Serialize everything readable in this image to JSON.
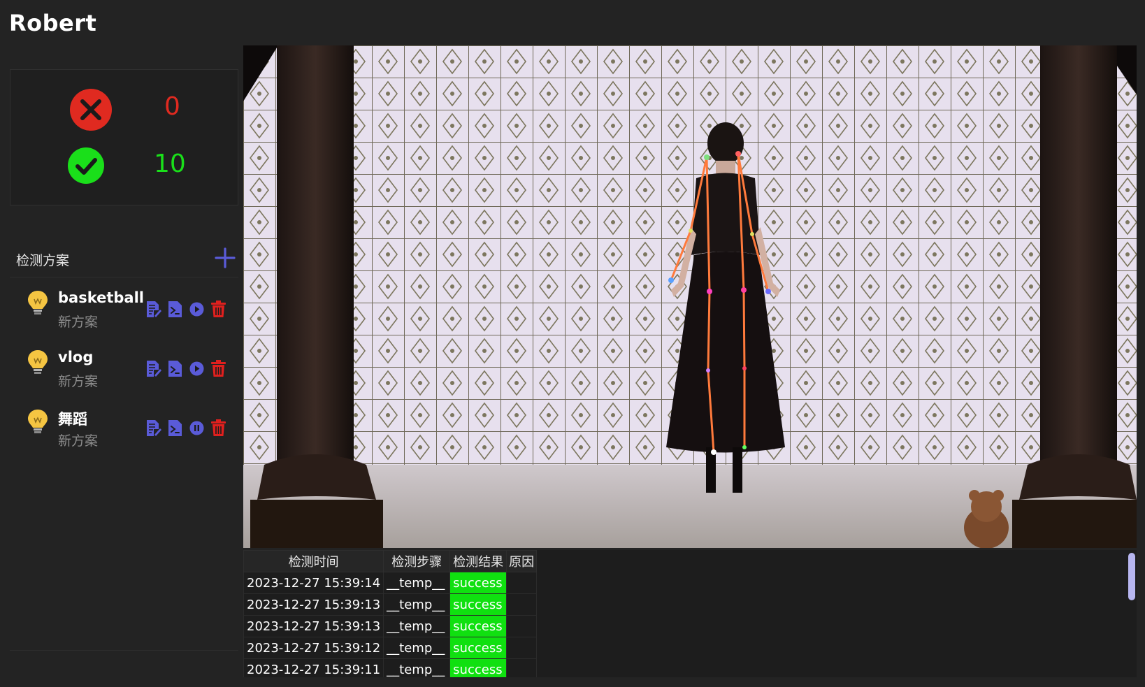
{
  "app": {
    "title": "Robert"
  },
  "stats": {
    "fail_icon": "close-circle-icon",
    "fail_count": "0",
    "fail_color": "#e02a20",
    "success_icon": "check-circle-icon",
    "success_count": "10",
    "success_color": "#1adf1a"
  },
  "plans": {
    "title": "检测方案",
    "add_icon": "plus-icon",
    "items": [
      {
        "name": "basketball",
        "desc": "新方案",
        "run_state": "play"
      },
      {
        "name": "vlog",
        "desc": "新方案",
        "run_state": "play"
      },
      {
        "name": "舞蹈",
        "desc": "新方案",
        "run_state": "pause"
      }
    ],
    "action_icons": [
      "edit-doc-icon",
      "terminal-icon",
      "play-icon",
      "trash-icon"
    ],
    "accent_color": "#5a5bd8",
    "delete_color": "#e0201e"
  },
  "log": {
    "columns": [
      "检测时间",
      "检测步骤",
      "检测结果",
      "原因"
    ],
    "rows": [
      {
        "time": "2023-12-27 15:39:14",
        "step": "__temp__",
        "result": "success",
        "reason": ""
      },
      {
        "time": "2023-12-27 15:39:13",
        "step": "__temp__",
        "result": "success",
        "reason": ""
      },
      {
        "time": "2023-12-27 15:39:13",
        "step": "__temp__",
        "result": "success",
        "reason": ""
      },
      {
        "time": "2023-12-27 15:39:12",
        "step": "__temp__",
        "result": "success",
        "reason": ""
      },
      {
        "time": "2023-12-27 15:39:11",
        "step": "__temp__",
        "result": "success",
        "reason": ""
      }
    ],
    "success_color": "#10e010"
  }
}
